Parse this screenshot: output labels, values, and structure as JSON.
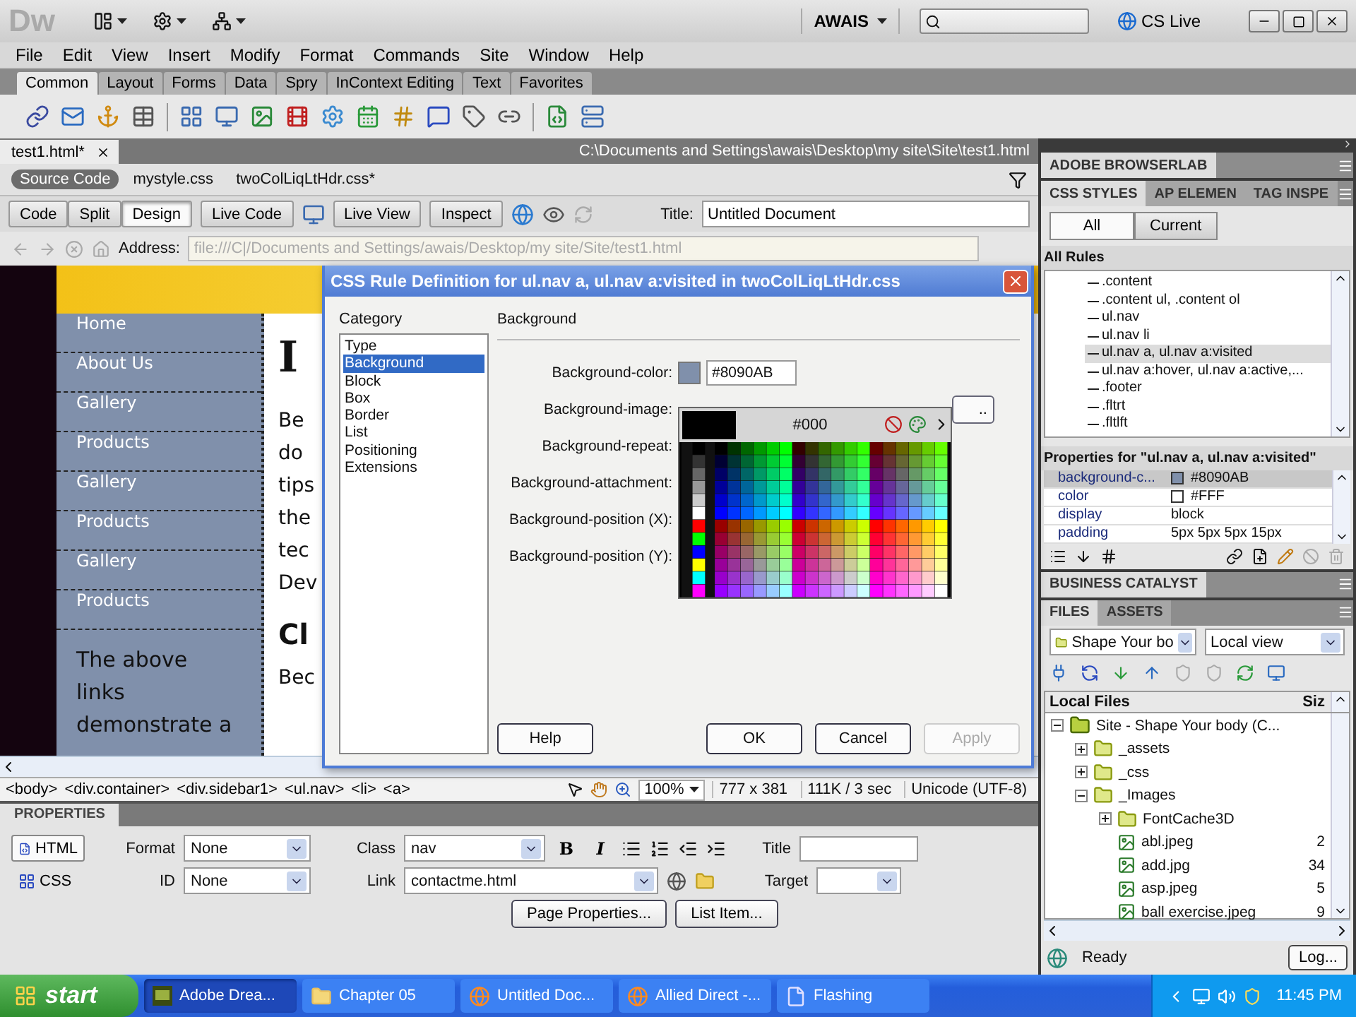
{
  "app_bar": {
    "logo": "Dw",
    "workspace": "AWAIS",
    "cs_live": "CS Live"
  },
  "menu": [
    "File",
    "Edit",
    "View",
    "Insert",
    "Modify",
    "Format",
    "Commands",
    "Site",
    "Window",
    "Help"
  ],
  "insert_tabs": [
    {
      "label": "Common",
      "selected": true
    },
    {
      "label": "Layout",
      "selected": false
    },
    {
      "label": "Forms",
      "selected": false
    },
    {
      "label": "Data",
      "selected": false
    },
    {
      "label": "Spry",
      "selected": false
    },
    {
      "label": "InContext Editing",
      "selected": false
    },
    {
      "label": "Text",
      "selected": false
    },
    {
      "label": "Favorites",
      "selected": false
    }
  ],
  "document": {
    "tab": "test1.html*",
    "path": "C:\\Documents and Settings\\awais\\Desktop\\my site\\Site\\test1.html",
    "related_files": [
      {
        "label": "Source Code",
        "selected": true
      },
      {
        "label": "mystyle.css",
        "selected": false
      },
      {
        "label": "twoColLiqLtHdr.css*",
        "selected": false
      }
    ],
    "view_buttons": [
      {
        "label": "Code",
        "selected": false
      },
      {
        "label": "Split",
        "selected": false
      },
      {
        "label": "Design",
        "selected": true
      }
    ],
    "live_code": "Live Code",
    "live_view": "Live View",
    "inspect": "Inspect",
    "title_label": "Title:",
    "title_value": "Untitled Document",
    "address_label": "Address:",
    "address_value": "file:///C|/Documents and Settings/awais/Desktop/my site/Site/test1.html"
  },
  "design_view": {
    "nav": [
      "Home",
      "About Us",
      "Gallery",
      "Products",
      "Gallery",
      "Products",
      "Gallery",
      "Products"
    ],
    "sidebar_text": "The above links demonstrate a",
    "heading": "I",
    "paragraph": "Be do tips the tec Dev",
    "heading_2": "Cl",
    "paragraph_2": "Bec"
  },
  "dialog": {
    "title": "CSS Rule Definition for ul.nav a, ul.nav a:visited in twoColLiqLtHdr.css",
    "category_label": "Category",
    "categories": [
      {
        "label": "Type",
        "selected": false
      },
      {
        "label": "Background",
        "selected": true
      },
      {
        "label": "Block",
        "selected": false
      },
      {
        "label": "Box",
        "selected": false
      },
      {
        "label": "Border",
        "selected": false
      },
      {
        "label": "List",
        "selected": false
      },
      {
        "label": "Positioning",
        "selected": false
      },
      {
        "label": "Extensions",
        "selected": false
      }
    ],
    "section": "Background",
    "fields": [
      {
        "kind": "color",
        "label": "Background-color:",
        "value": "#8090AB",
        "color": "#8090ab"
      },
      {
        "kind": "browse",
        "label": "Background-image:",
        "button": ".."
      },
      {
        "kind": "select",
        "label": "Background-repeat:"
      },
      {
        "kind": "select",
        "label": "Background-attachment:"
      },
      {
        "kind": "select",
        "label": "Background-position (X):"
      },
      {
        "kind": "select",
        "label": "Background-position (Y):"
      }
    ],
    "picker": {
      "value": "#000"
    },
    "buttons": [
      {
        "label": "Help",
        "disabled": false
      },
      {
        "label": "OK",
        "disabled": false
      },
      {
        "label": "Cancel",
        "disabled": false
      },
      {
        "label": "Apply",
        "disabled": true
      }
    ]
  },
  "status_bar": {
    "tags": [
      "<body>",
      "<div.container>",
      "<div.sidebar1>",
      "<ul.nav>",
      "<li>",
      "<a>"
    ],
    "zoom": "100%",
    "size": "777 x 381",
    "download": "111K / 3 sec",
    "encoding": "Unicode (UTF-8)"
  },
  "properties": {
    "title": "PROPERTIES",
    "modes": [
      {
        "label": "HTML",
        "selected": true
      },
      {
        "label": "CSS",
        "selected": false
      }
    ],
    "format_label": "Format",
    "format": "None",
    "id_label": "ID",
    "id": "None",
    "class_label": "Class",
    "class": "nav",
    "link_label": "Link",
    "link": "contactme.html",
    "style_buttons": [
      "B",
      "I"
    ],
    "title_label": "Title",
    "target_label": "Target",
    "buttons": [
      "Page Properties...",
      "List Item..."
    ]
  },
  "panels": {
    "browserlab": "ADOBE BROWSERLAB",
    "css_tabs": [
      {
        "label": "CSS STYLES",
        "selected": true
      },
      {
        "label": "AP ELEMEN",
        "selected": false
      },
      {
        "label": "TAG INSPE",
        "selected": false
      }
    ],
    "modes": [
      {
        "label": "All",
        "selected": true
      },
      {
        "label": "Current",
        "selected": false
      }
    ],
    "rules_label": "All Rules",
    "rules": [
      {
        "label": ".content",
        "selected": false
      },
      {
        "label": ".content ul, .content ol",
        "selected": false
      },
      {
        "label": "ul.nav",
        "selected": false
      },
      {
        "label": "ul.nav li",
        "selected": false
      },
      {
        "label": "ul.nav a, ul.nav a:visited",
        "selected": true
      },
      {
        "label": "ul.nav a:hover, ul.nav a:active,...",
        "selected": false
      },
      {
        "label": ".footer",
        "selected": false
      },
      {
        "label": ".fltrt",
        "selected": false
      },
      {
        "label": ".fltlft",
        "selected": false
      }
    ],
    "properties_label": "Properties for \"ul.nav a, ul.nav a:visited\"",
    "properties": [
      {
        "name": "background-c...",
        "value": "#8090AB",
        "color": "#8090ab",
        "selected": true
      },
      {
        "name": "color",
        "value": "#FFF",
        "color": "#ffffff",
        "selected": false
      },
      {
        "name": "display",
        "value": "block",
        "selected": false
      },
      {
        "name": "padding",
        "value": "5px 5px 5px 15px",
        "selected": false
      }
    ],
    "business_catalyst": "BUSINESS CATALYST",
    "file_tabs": [
      {
        "label": "FILES",
        "selected": true
      },
      {
        "label": "ASSETS",
        "selected": false
      }
    ],
    "site": "Shape Your bo",
    "view": "Local view",
    "files_header": "Local Files",
    "size_header": "Siz",
    "tree": [
      {
        "kind": "site",
        "label": "Site - Shape Your body (C...",
        "expanded": true,
        "children": [
          {
            "kind": "folder",
            "label": "_assets",
            "expanded": false
          },
          {
            "kind": "folder",
            "label": "_css",
            "expanded": false
          },
          {
            "kind": "folder",
            "label": "_Images",
            "expanded": true,
            "children": [
              {
                "kind": "folder",
                "label": "FontCache3D",
                "expanded": false
              },
              {
                "kind": "file",
                "label": "abl.jpeg",
                "size": "2"
              },
              {
                "kind": "file",
                "label": "add.jpg",
                "size": "34"
              },
              {
                "kind": "file",
                "label": "asp.jpeg",
                "size": "5"
              },
              {
                "kind": "file",
                "label": "ball exercise.jpeg",
                "size": "9"
              }
            ]
          }
        ]
      }
    ],
    "status": "Ready",
    "log": "Log..."
  },
  "taskbar": {
    "start": "start",
    "items": [
      {
        "kind": "app",
        "label": "Adobe Drea...",
        "selected": true
      },
      {
        "kind": "folder",
        "label": "Chapter 05",
        "selected": false
      },
      {
        "kind": "browser",
        "label": "Untitled Doc...",
        "selected": false
      },
      {
        "kind": "browser",
        "label": "Allied Direct -...",
        "selected": false
      },
      {
        "kind": "document",
        "label": "Flashing",
        "selected": false
      }
    ],
    "clock": "11:45 PM"
  }
}
